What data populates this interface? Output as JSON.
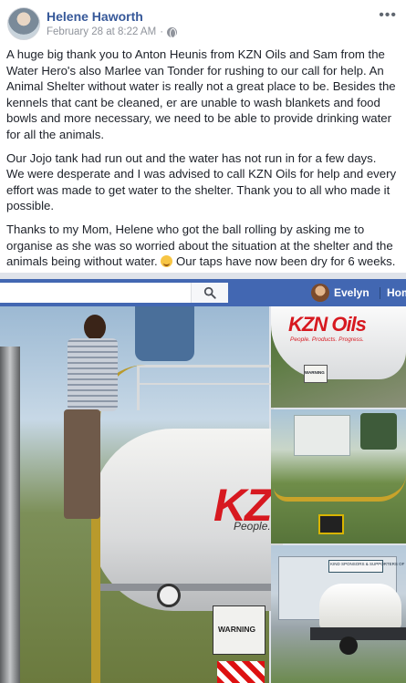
{
  "post": {
    "author": "Helene Haworth",
    "timestamp": "February 28 at 8:22 AM",
    "paragraphs": [
      "A huge big thank you to Anton Heunis from KZN Oils and Sam from the Water Hero's also Marlee van Tonder for rushing to our call for help. An Animal Shelter without water is really not a great place to be. Besides the kennels that cant be cleaned, er are unable to wash blankets and food bowls and more necessary, we need to be able to provide drinking water for all the animals.",
      "Our Jojo tank had run out and the water has not run in for a few days. We were desperate and I was advised to call KZN Oils for help and every effort was made to get water to the shelter. Thank you to all who made it possible."
    ],
    "paragraph3_start": "Thanks to my Mom, Helene who got the ball rolling by asking me to organise as she was so worried about the situation at the shelter and the animals being without water.",
    "paragraph3_end": " Our taps have now been dry for 6 weeks."
  },
  "navbar": {
    "search_placeholder": "",
    "user_name": "Evelyn",
    "home_label": "Hom"
  },
  "photos": {
    "main_brand": "KZN",
    "main_tagline": "People.",
    "main_warning": "WARNING",
    "top_right_brand": "KZN Oils",
    "top_right_tagline": "People. Products. Progress.",
    "top_right_warning": "WARNING",
    "bottom_right_sign": "KIND SPONSORS & SUPPORTERS OF"
  },
  "colors": {
    "link": "#365899",
    "fb_blue": "#4267b2",
    "brand_red": "#d71920"
  }
}
